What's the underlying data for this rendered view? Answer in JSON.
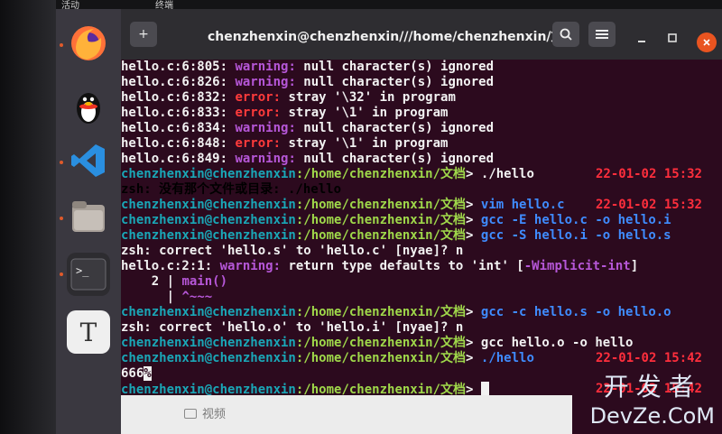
{
  "system_bar": {
    "activities": "活动",
    "app_menu": "终端"
  },
  "dock": {
    "items": [
      {
        "name": "firefox-icon"
      },
      {
        "name": "qq-penguin-icon"
      },
      {
        "name": "vscode-icon"
      },
      {
        "name": "files-folder-icon"
      },
      {
        "name": "terminal-icon"
      },
      {
        "name": "text-editor-icon",
        "glyph": "T"
      }
    ]
  },
  "terminal": {
    "title": "chenzhenxin@chenzhenxin///home/chenzhenxin/文档",
    "new_tab_glyph": "+",
    "lines": [
      {
        "pre": "hello.c:6:805: ",
        "level": "warning:",
        "lvl": "warn",
        "msg": " null character(s) ignored"
      },
      {
        "pre": "hello.c:6:826: ",
        "level": "warning:",
        "lvl": "warn",
        "msg": " null character(s) ignored"
      },
      {
        "pre": "hello.c:6:832: ",
        "level": "error:",
        "lvl": "err",
        "msg": " stray '\\32' in program"
      },
      {
        "pre": "hello.c:6:833: ",
        "level": "error:",
        "lvl": "err",
        "msg": " stray '\\1' in program"
      },
      {
        "pre": "hello.c:6:834: ",
        "level": "warning:",
        "lvl": "warn",
        "msg": " null character(s) ignored"
      },
      {
        "pre": "hello.c:6:848: ",
        "level": "error:",
        "lvl": "err",
        "msg": " stray '\\1' in program"
      },
      {
        "pre": "hello.c:6:849: ",
        "level": "warning:",
        "lvl": "warn",
        "msg": " null character(s) ignored"
      }
    ],
    "prompt_user": "chenzhenxin@chenzhenxin",
    "prompt_path": ":/home/chenzhenxin/文档",
    "prompt_symbol": "> ",
    "commands": [
      {
        "cmd": "./hello",
        "ts": "22-01-02 15:32"
      },
      {
        "cmd": "vim hello.c",
        "ts": "22-01-02 15:32"
      },
      {
        "cmd": "gcc -E hello.c -o hello.i",
        "ts": ""
      },
      {
        "cmd": "gcc -S hello.i -o hello.s",
        "ts": ""
      },
      {
        "cmd": "gcc -c hello.s -o hello.o",
        "ts": ""
      },
      {
        "cmd": "gcc hello.o -o hello",
        "ts": ""
      },
      {
        "cmd": "./hello",
        "ts": "22-01-02 15:42"
      }
    ],
    "zsh_not_found": "zsh: 没有那个文件或目录: ./hello",
    "zsh_correct_1": "zsh: correct 'hello.s' to 'hello.c' [nyae]? n",
    "warn_return_pre": "hello.c:2:1: ",
    "warn_return_level": "warning:",
    "warn_return_msg": " return type defaults to 'int' [",
    "warn_return_flag": "-Wimplicit-int",
    "warn_return_close": "]",
    "src_line_no": "    2 | ",
    "src_line_code": "main()",
    "src_caret_bar": "      | ",
    "src_caret": "^~~~",
    "zsh_correct_2": "zsh: correct 'hello.o' to 'hello.i' [nyae]? n",
    "program_output": "666",
    "program_output_mark": "%",
    "last_ts_partial": "22-01-02 15:42"
  },
  "file_manager": {
    "folder_label": "视频"
  },
  "watermark": {
    "line1": "开发者",
    "line2": "DevZe.CoM"
  }
}
